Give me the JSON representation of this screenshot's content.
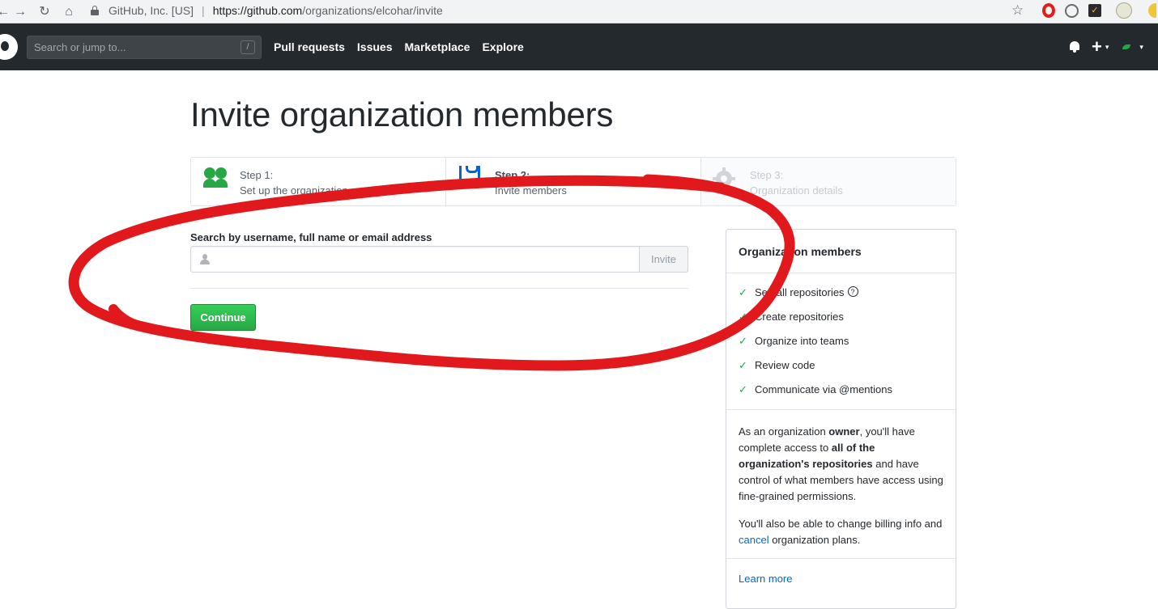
{
  "browser": {
    "back": "←",
    "forward": "→",
    "reload": "↻",
    "home": "⌂",
    "site_identity": "GitHub, Inc. [US]",
    "url_host": "https://github.com",
    "url_path": "/organizations/elcohar/invite",
    "bookmark_star": "☆"
  },
  "header": {
    "search_placeholder": "Search or jump to...",
    "slash_key": "/",
    "nav": [
      "Pull requests",
      "Issues",
      "Marketplace",
      "Explore"
    ],
    "plus": "+",
    "caret": "▾"
  },
  "page": {
    "title": "Invite organization members"
  },
  "steps": [
    {
      "title": "Step 1:",
      "subtitle": "Set up the organization",
      "icon": "people-icon",
      "state": "done"
    },
    {
      "title": "Step 2:",
      "subtitle": "Invite members",
      "icon": "jersey-icon",
      "state": "current"
    },
    {
      "title": "Step 3:",
      "subtitle": "Organization details",
      "icon": "gear-icon",
      "state": "future"
    }
  ],
  "form": {
    "label": "Search by username, full name or email address",
    "input_value": "",
    "invite_label": "Invite",
    "continue_label": "Continue"
  },
  "sidebar": {
    "title": "Organization members",
    "permissions": [
      "See all repositories",
      "Create repositories",
      "Organize into teams",
      "Review code",
      "Communicate via @mentions"
    ],
    "help_mark": "?",
    "check_mark": "✓",
    "owner_text": {
      "p1": "As an organization ",
      "owner": "owner",
      "p2": ", you'll have complete access to ",
      "all_repos": "all of the organization's repositories",
      "p3": " and have control of what members have access using fine-grained permissions."
    },
    "billing_text": {
      "p1": "You'll also be able to change billing info and ",
      "cancel": "cancel",
      "p2": " organization plans."
    },
    "learn_more": "Learn more"
  },
  "colors": {
    "header_bg": "#24292e",
    "accent_green": "#28a745",
    "link_blue": "#0366d6",
    "annotation_red": "#e2191c"
  }
}
